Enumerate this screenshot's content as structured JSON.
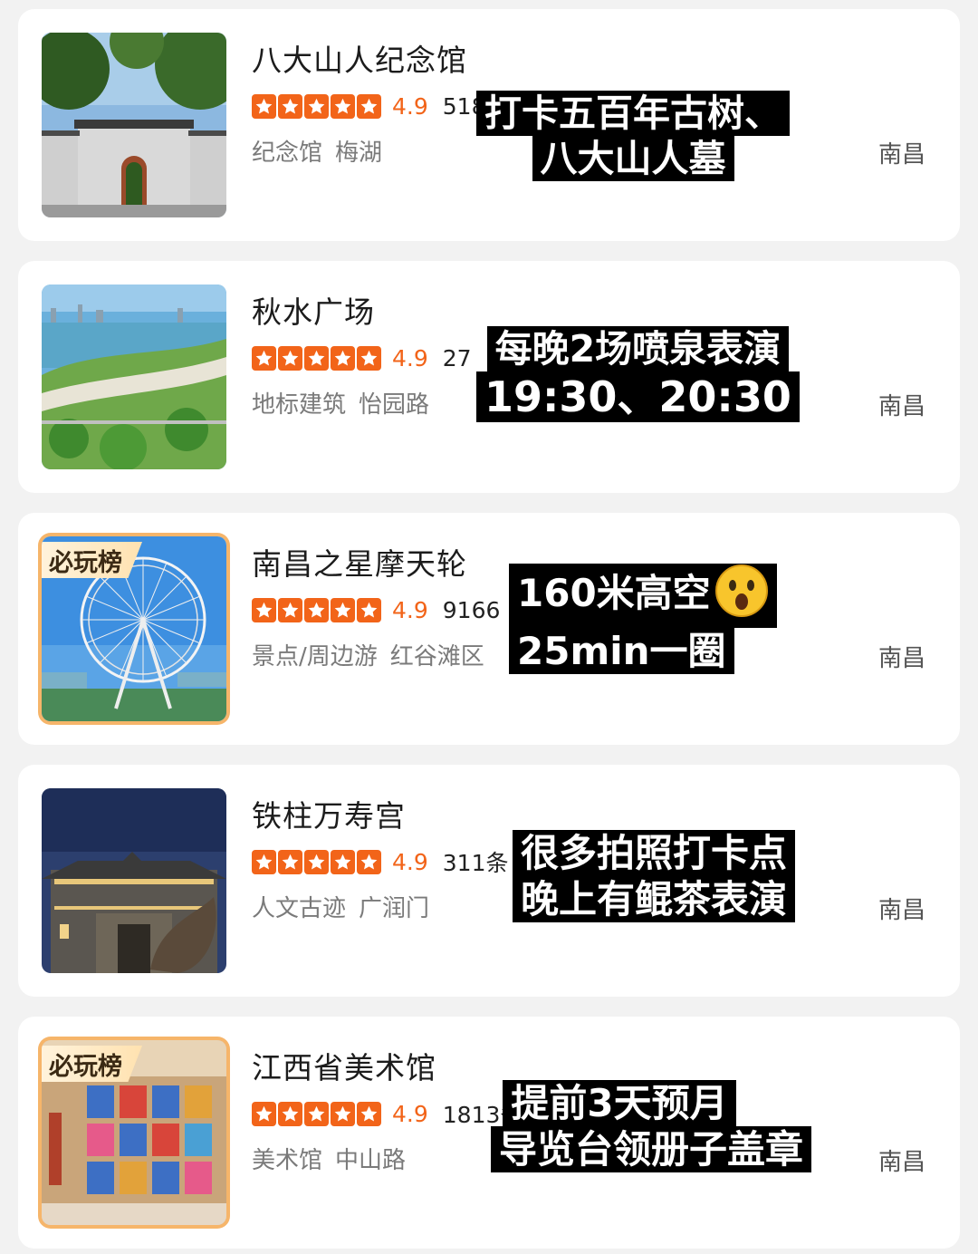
{
  "listings": [
    {
      "title": "八大山人纪念馆",
      "score": "4.9",
      "count": "518",
      "tags": [
        "纪念馆",
        "梅湖"
      ],
      "city": "南昌",
      "thumb_icon": "memorial-gate-photo",
      "overlay": [
        "打卡五百年古树、",
        "八大山人墓"
      ]
    },
    {
      "title": "秋水广场",
      "score": "4.9",
      "count": "27",
      "tags": [
        "地标建筑",
        "怡园路"
      ],
      "city": "南昌",
      "thumb_icon": "river-square-photo",
      "overlay": [
        "每晚2场喷泉表演",
        "19:30、20:30"
      ]
    },
    {
      "title": "南昌之星摩天轮",
      "score": "4.9",
      "count": "9166",
      "tags": [
        "景点/周边游",
        "红谷滩区"
      ],
      "city": "南昌",
      "badge": "必玩榜",
      "thumb_icon": "ferris-wheel-photo",
      "overlay": [
        "160米高空",
        "25min一圈"
      ],
      "overlay_emoji": "astonished-face-emoji"
    },
    {
      "title": "铁柱万寿宫",
      "score": "4.9",
      "count": "311条",
      "tags": [
        "人文古迹",
        "广润门"
      ],
      "city": "南昌",
      "thumb_icon": "temple-night-photo",
      "overlay": [
        "很多拍照打卡点",
        "晚上有鲲茶表演"
      ]
    },
    {
      "title": "江西省美术馆",
      "score": "4.9",
      "count": "1813条",
      "tags": [
        "美术馆",
        "中山路"
      ],
      "city": "南昌",
      "badge": "必玩榜",
      "thumb_icon": "art-gallery-photo",
      "overlay": [
        "提前3天预月",
        "导览台领册子盖章"
      ]
    }
  ],
  "colors": {
    "accent": "#f26419",
    "background": "#f2f2f2",
    "card": "#ffffff",
    "overlay": "#000000"
  }
}
